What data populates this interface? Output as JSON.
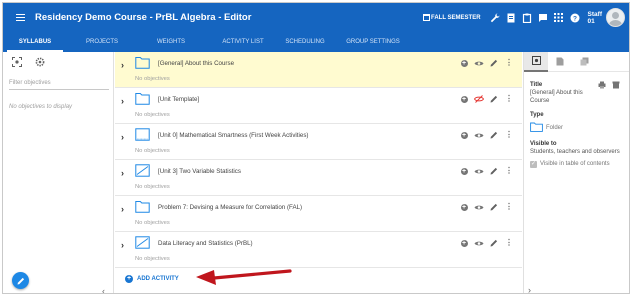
{
  "app": {
    "title": "Residency Demo Course - PrBL Algebra - Editor",
    "semester_label": "FALL SEMESTER",
    "staff_line1": "Staff",
    "staff_line2": "01"
  },
  "tabs": [
    {
      "label": "SYLLABUS",
      "active": true
    },
    {
      "label": "PROJECTS",
      "active": false
    },
    {
      "label": "WEIGHTS",
      "active": false
    },
    {
      "label": "ACTIVITY LIST",
      "active": false
    },
    {
      "label": "SCHEDULING",
      "active": false
    },
    {
      "label": "GROUP SETTINGS",
      "active": false
    }
  ],
  "left_panel": {
    "filter_placeholder": "Filter objectives",
    "empty_text": "No objectives to display"
  },
  "activities": [
    {
      "title": "[General] About this Course",
      "objectives": "No objectives",
      "icon": "folder-icon",
      "highlight": true,
      "visibility": "visible"
    },
    {
      "title": "[Unit Template]",
      "objectives": "No objectives",
      "icon": "folder-icon",
      "highlight": false,
      "visibility": "hidden"
    },
    {
      "title": "[Unit 0] Mathematical Smartness (First Week Activities)",
      "objectives": "No objectives",
      "icon": "unit-chart-icon",
      "highlight": false,
      "visibility": "visible"
    },
    {
      "title": "[Unit 3] Two Variable Statistics",
      "objectives": "No objectives",
      "icon": "line-chart-icon",
      "highlight": false,
      "visibility": "visible"
    },
    {
      "title": "Problem 7: Devising a Measure for Correlation (FAL)",
      "objectives": "No objectives",
      "icon": "folder-icon",
      "highlight": false,
      "visibility": "visible"
    },
    {
      "title": "Data Literacy and Statistics (PrBL)",
      "objectives": "No objectives",
      "icon": "line-chart-icon",
      "highlight": false,
      "visibility": "visible"
    }
  ],
  "add_activity_label": "ADD ACTIVITY",
  "right_panel": {
    "title_label": "Title",
    "title_value_line1": "[General] About this",
    "title_value_line2": "Course",
    "type_label": "Type",
    "type_value": "Folder",
    "visible_label": "Visible to",
    "visible_value": "Students, teachers and observers",
    "toc_label": "Visible in table of contents",
    "toc_checked": true
  },
  "colors": {
    "brand": "#1565c0",
    "highlight_row": "#fffbd0",
    "accent_link": "#1976d2",
    "annotation_arrow": "#c0161d"
  }
}
